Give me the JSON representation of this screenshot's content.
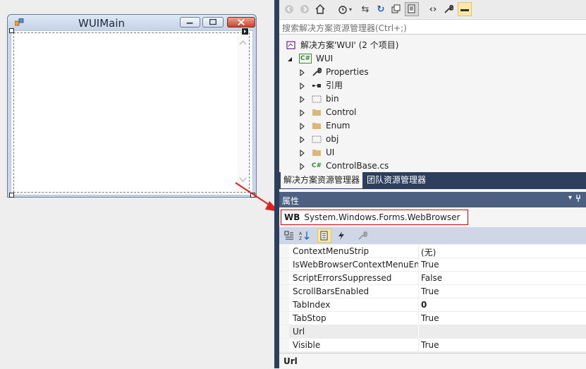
{
  "form": {
    "title": "WUIMain"
  },
  "solution_explorer": {
    "search_placeholder": "搜索解决方案资源管理器(Ctrl+;)",
    "solution_label": "解决方案'WUI' (2 个项目)",
    "project_label": "WUI",
    "items": [
      {
        "label": "Properties",
        "icon": "wrench-icon"
      },
      {
        "label": "引用",
        "icon": "references-icon"
      },
      {
        "label": "bin",
        "icon": "folder-dashed-icon"
      },
      {
        "label": "Control",
        "icon": "folder-icon"
      },
      {
        "label": "Enum",
        "icon": "folder-icon"
      },
      {
        "label": "obj",
        "icon": "folder-dashed-icon"
      },
      {
        "label": "UI",
        "icon": "folder-icon"
      },
      {
        "label": "ControlBase.cs",
        "icon": "csharp-file-icon"
      }
    ],
    "tabs": [
      "解决方案资源管理器",
      "团队资源管理器"
    ]
  },
  "properties": {
    "title": "属性",
    "object_type_badge": "WB",
    "object_name": "System.Windows.Forms.WebBrowser",
    "rows": [
      {
        "name": "ContextMenuStrip",
        "value": "(无)"
      },
      {
        "name": "IsWebBrowserContextMenuEn",
        "value": "True"
      },
      {
        "name": "ScriptErrorsSuppressed",
        "value": "False"
      },
      {
        "name": "ScrollBarsEnabled",
        "value": "True"
      },
      {
        "name": "TabIndex",
        "value": "0"
      },
      {
        "name": "TabStop",
        "value": "True"
      },
      {
        "name": "Url",
        "value": ""
      },
      {
        "name": "Visible",
        "value": "True"
      }
    ],
    "description_name": "Url"
  },
  "colors": {
    "accent_red": "#e00000",
    "panel_dark": "#2d3f5d",
    "header_blue": "#4d6082"
  }
}
